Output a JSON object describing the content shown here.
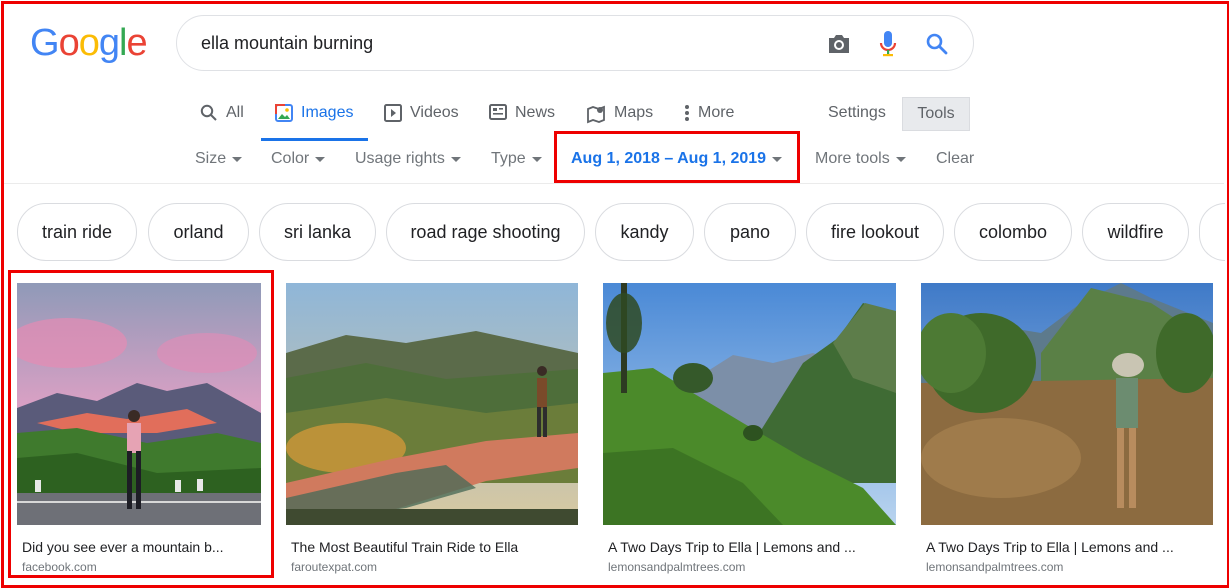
{
  "logo": {
    "letters": [
      "G",
      "o",
      "o",
      "g",
      "l",
      "e"
    ],
    "colors": [
      "#4285f4",
      "#ea4335",
      "#fbbc05",
      "#4285f4",
      "#34a853",
      "#ea4335"
    ]
  },
  "search": {
    "query": "ella mountain burning"
  },
  "tabs": [
    {
      "label": "All",
      "icon": "search-icon"
    },
    {
      "label": "Images",
      "icon": "images-icon",
      "active": true
    },
    {
      "label": "Videos",
      "icon": "play-icon"
    },
    {
      "label": "News",
      "icon": "news-icon"
    },
    {
      "label": "Maps",
      "icon": "map-pin-icon"
    },
    {
      "label": "More",
      "icon": "more-vert-icon"
    }
  ],
  "settings_label": "Settings",
  "tools_label": "Tools",
  "filters": [
    {
      "label": "Size"
    },
    {
      "label": "Color"
    },
    {
      "label": "Usage rights"
    },
    {
      "label": "Type"
    },
    {
      "label": "Aug 1, 2018 – Aug 1, 2019",
      "highlighted": true
    },
    {
      "label": "More tools"
    },
    {
      "label": "Clear"
    }
  ],
  "chips": [
    "train ride",
    "orland",
    "sri lanka",
    "road rage shooting",
    "kandy",
    "pano",
    "fire lookout",
    "colombo",
    "wildfire"
  ],
  "results": [
    {
      "title": "Did you see ever a mountain b...",
      "domain": "facebook.com"
    },
    {
      "title": "The Most Beautiful Train Ride to Ella",
      "domain": "faroutexpat.com"
    },
    {
      "title": "A Two Days Trip to Ella | Lemons and ...",
      "domain": "lemonsandpalmtrees.com"
    },
    {
      "title": "A Two Days Trip to Ella | Lemons and ...",
      "domain": "lemonsandpalmtrees.com"
    }
  ],
  "colors": {
    "accent": "#1a73e8",
    "highlight": "#ee0000",
    "muted": "#70757a"
  }
}
